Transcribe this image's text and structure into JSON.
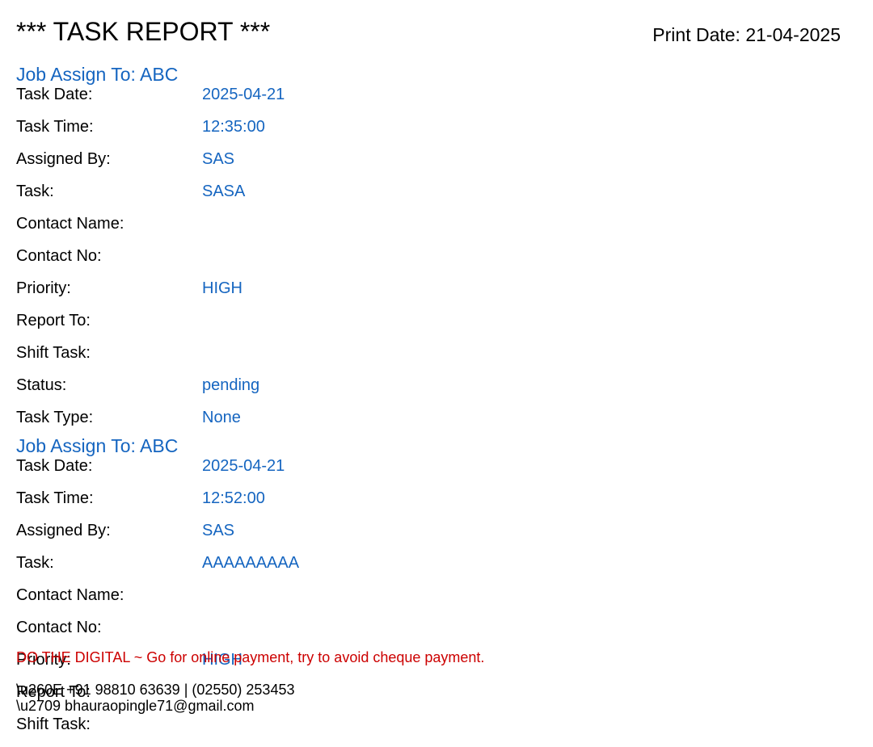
{
  "header": {
    "title": "*** TASK REPORT ***",
    "print_date": "Print Date: 21-04-2025"
  },
  "colors": {
    "value_blue": "#1565c0",
    "note_red": "#cc0000"
  },
  "tasks": [
    {
      "job_assign": "Job Assign To: ABC",
      "fields": [
        {
          "label": "Task Date:",
          "value": "2025-04-21"
        },
        {
          "label": "Task Time:",
          "value": "12:35:00"
        },
        {
          "label": "Assigned By:",
          "value": "SAS"
        },
        {
          "label": "Task:",
          "value": "SASA"
        },
        {
          "label": "Contact Name:",
          "value": ""
        },
        {
          "label": "Contact No:",
          "value": ""
        },
        {
          "label": "Priority:",
          "value": "HIGH"
        },
        {
          "label": "Report To:",
          "value": ""
        },
        {
          "label": "Shift Task:",
          "value": ""
        },
        {
          "label": "Status:",
          "value": "pending"
        },
        {
          "label": "Task Type:",
          "value": "None"
        }
      ]
    },
    {
      "job_assign": "Job Assign To: ABC",
      "fields": [
        {
          "label": "Task Date:",
          "value": "2025-04-21"
        },
        {
          "label": "Task Time:",
          "value": "12:52:00"
        },
        {
          "label": "Assigned By:",
          "value": "SAS"
        },
        {
          "label": "Task:",
          "value": "AAAAAAAAA"
        },
        {
          "label": "Contact Name:",
          "value": ""
        },
        {
          "label": "Contact No:",
          "value": ""
        },
        {
          "label": "Priority:",
          "value": "HIGH"
        },
        {
          "label": "Report To:",
          "value": ""
        },
        {
          "label": "Shift Task:",
          "value": ""
        }
      ]
    }
  ],
  "footer": {
    "note": "DO THE DIGITAL ~ Go for online payment, try to avoid cheque payment.",
    "phone": "\\u260E +91 98810 63639 | (02550) 253453",
    "email": "\\u2709 bhauraopingle71@gmail.com"
  }
}
